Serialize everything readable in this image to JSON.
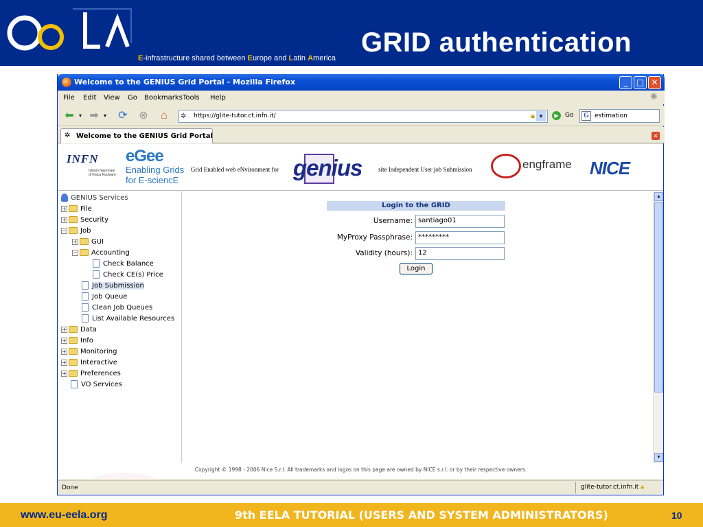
{
  "slide": {
    "title": "GRID authentication",
    "logo_text": "ee la",
    "tagline": {
      "e1": "E",
      "t1": "-infrastructure shared between ",
      "e2": "E",
      "t2": "urope and ",
      "l": "L",
      "t3": "atin ",
      "a": "A",
      "t4": "merica"
    },
    "footer_url": "www.eu-eela.org",
    "footer_title": "9th EELA TUTORIAL (USERS AND SYSTEM ADMINISTRATORS)",
    "page_number": "10",
    "colors": {
      "header_blue": "#002a8c",
      "footer_gold": "#f1b51e"
    }
  },
  "browser": {
    "window_title": "Welcome to the GENIUS Grid Portal - Mozilla Firefox",
    "menu": [
      "File",
      "Edit",
      "View",
      "Go",
      "Bookmarks",
      "Tools",
      "Help"
    ],
    "url": "https://glite-tutor.ct.infn.it/",
    "go_label": "Go",
    "search_value": "estimation",
    "tab_label": "Welcome to the GENIUS Grid Portal",
    "status_left": "Done",
    "status_host": "glite-tutor.ct.infn.it",
    "icons": [
      "back-icon",
      "forward-icon",
      "reload-icon",
      "stop-icon",
      "home-icon",
      "lock-icon",
      "go-icon",
      "google-icon"
    ]
  },
  "banner": {
    "infn": "INFN",
    "infn_sub1": "Istituto Nazionale",
    "infn_sub2": "di Fisica Nucleare",
    "egee": "eGee",
    "egee_line1": "Enabling Grids",
    "egee_line2": "for E-sciencE",
    "genius_pre": "Grid Enabled web eNvironment for",
    "genius": "genius",
    "genius_post": "site Independent User job Submission",
    "engframe": "engframe",
    "nice": "NICE"
  },
  "sidebar": {
    "header": "GENIUS Services",
    "items": [
      {
        "label": "File",
        "type": "folder",
        "exp": "+"
      },
      {
        "label": "Security",
        "type": "folder",
        "exp": "+"
      },
      {
        "label": "Job",
        "type": "folder",
        "exp": "−"
      },
      {
        "label": "GUI",
        "type": "folder",
        "exp": "+"
      },
      {
        "label": "Accounting",
        "type": "folder",
        "exp": "−"
      },
      {
        "label": "Check Balance",
        "type": "doc"
      },
      {
        "label": "Check CE(s) Price",
        "type": "doc"
      },
      {
        "label": "Job Submission",
        "type": "doc",
        "selected": true
      },
      {
        "label": "Job Queue",
        "type": "doc"
      },
      {
        "label": "Clean Job Queues",
        "type": "doc"
      },
      {
        "label": "List Available Resources",
        "type": "doc"
      },
      {
        "label": "Data",
        "type": "folder",
        "exp": "+"
      },
      {
        "label": "Info",
        "type": "folder",
        "exp": "+"
      },
      {
        "label": "Monitoring",
        "type": "folder",
        "exp": "+"
      },
      {
        "label": "Interactive",
        "type": "folder",
        "exp": "+"
      },
      {
        "label": "Preferences",
        "type": "folder",
        "exp": "+"
      },
      {
        "label": "VO Services",
        "type": "doc"
      }
    ]
  },
  "login": {
    "heading": "Login to the GRID",
    "username_label": "Username:",
    "username_value": "santiago01",
    "passphrase_label": "MyProxy Passphrase:",
    "passphrase_value": "*********",
    "validity_label": "Validity (hours):",
    "validity_value": "12",
    "button": "Login"
  },
  "copyright": "Copyright © 1998 - 2006 Nice S.r.l. All trademarks and logos on this page are owned by NICE s.r.l. or by their respective owners."
}
